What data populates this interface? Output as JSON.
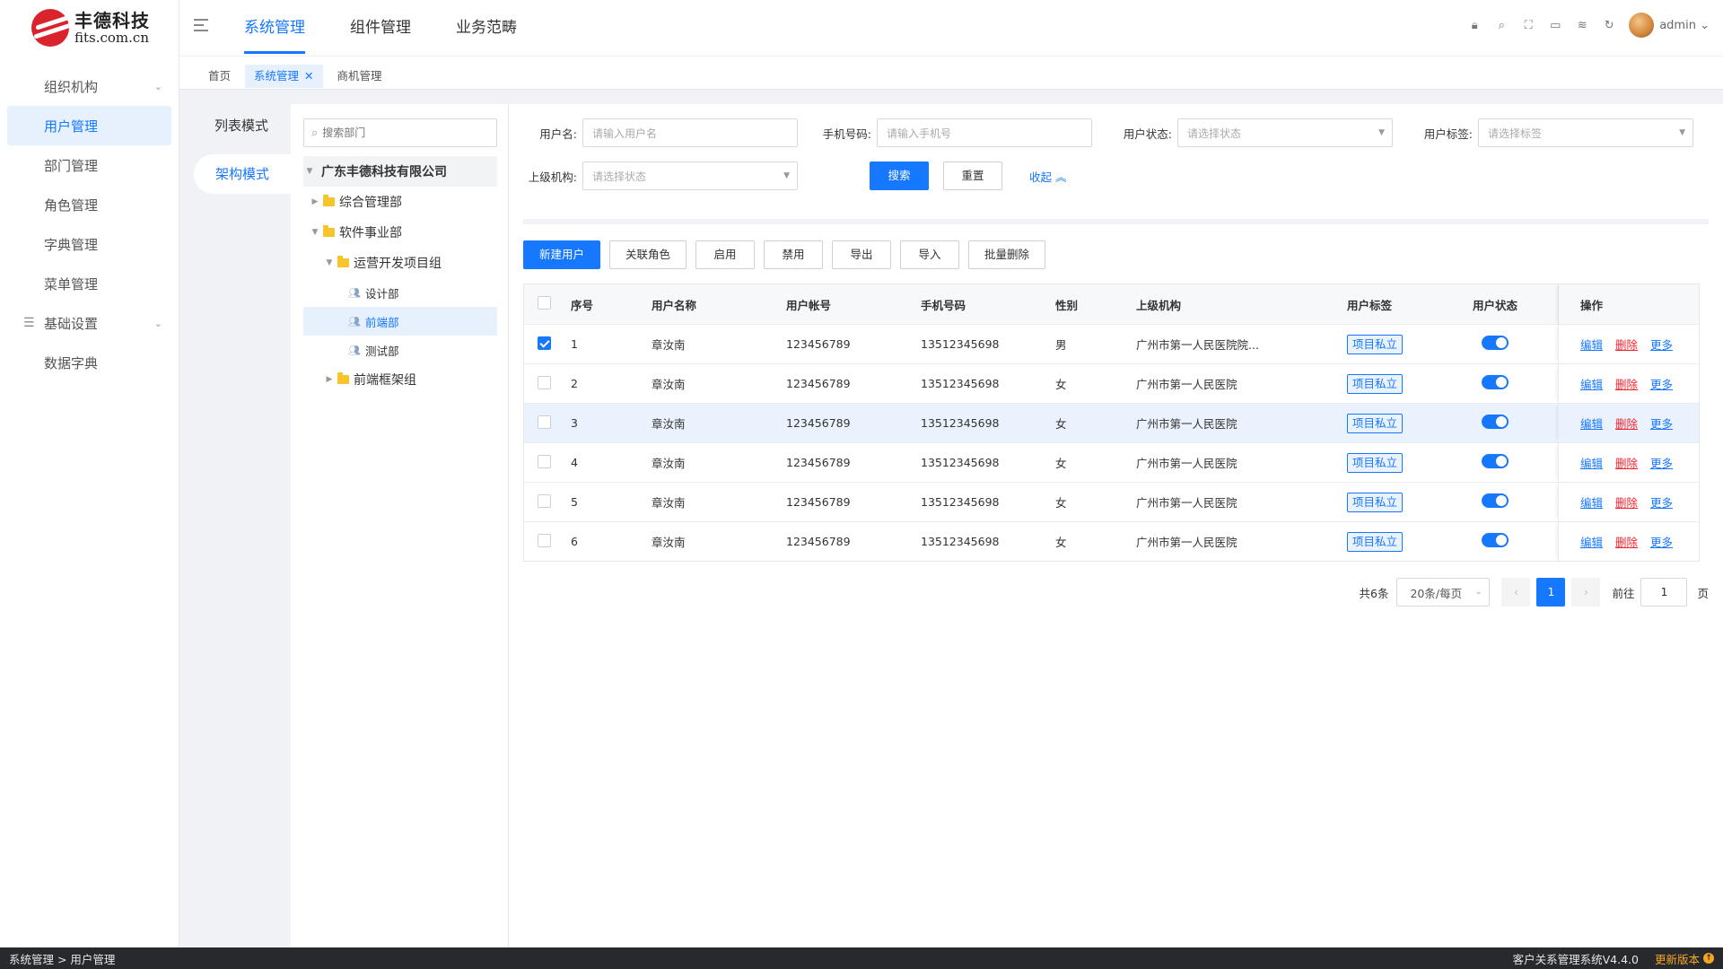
{
  "logo": {
    "cn": "丰德科技",
    "en": "fits.com.cn"
  },
  "sidebar": {
    "items": [
      {
        "label": "组织机构"
      },
      {
        "label": "用户管理"
      },
      {
        "label": "部门管理"
      },
      {
        "label": "角色管理"
      },
      {
        "label": "字典管理"
      },
      {
        "label": "菜单管理"
      },
      {
        "label": "基础设置"
      },
      {
        "label": "数据字典"
      }
    ]
  },
  "topnav": {
    "items": [
      {
        "label": "系统管理"
      },
      {
        "label": "组件管理"
      },
      {
        "label": "业务范畴"
      }
    ]
  },
  "user": {
    "name": "admin"
  },
  "tabs": [
    {
      "label": "首页"
    },
    {
      "label": "系统管理"
    },
    {
      "label": "商机管理"
    }
  ],
  "modes": [
    {
      "label": "列表模式"
    },
    {
      "label": "架构模式"
    }
  ],
  "tree": {
    "search_placeholder": "搜索部门",
    "root": "广东丰德科技有限公司",
    "n1": "综合管理部",
    "n2": "软件事业部",
    "n3": "运营开发项目组",
    "n4": "设计部",
    "n5": "前端部",
    "n6": "测试部",
    "n7": "前端框架组"
  },
  "filters": {
    "username_label": "用户名:",
    "username_placeholder": "请输入用户名",
    "phone_label": "手机号码:",
    "phone_placeholder": "请输入手机号",
    "status_label": "用户状态:",
    "status_placeholder": "请选择状态",
    "tag_label": "用户标签:",
    "tag_placeholder": "请选择标签",
    "org_label": "上级机构:",
    "org_placeholder": "请选择状态",
    "search_btn": "搜索",
    "reset_btn": "重置",
    "collapse_link": "收起"
  },
  "toolbar": {
    "new_user": "新建用户",
    "link_role": "关联角色",
    "enable": "启用",
    "disable": "禁用",
    "export": "导出",
    "import": "导入",
    "batch_delete": "批量删除"
  },
  "table": {
    "headers": {
      "no": "序号",
      "name": "用户名称",
      "account": "用户帐号",
      "phone": "手机号码",
      "sex": "性别",
      "org": "上级机构",
      "tag": "用户标签",
      "status": "用户状态",
      "ops": "操作"
    },
    "op_labels": {
      "edit": "编辑",
      "delete": "删除",
      "more": "更多"
    },
    "rows": [
      {
        "no": "1",
        "name": "章汝南",
        "account": "123456789",
        "phone": "13512345698",
        "sex": "男",
        "org": "广州市第一人民医院院...",
        "tag": "项目私立",
        "checked": true,
        "enabled": true
      },
      {
        "no": "2",
        "name": "章汝南",
        "account": "123456789",
        "phone": "13512345698",
        "sex": "女",
        "org": "广州市第一人民医院",
        "tag": "项目私立",
        "checked": false,
        "enabled": true
      },
      {
        "no": "3",
        "name": "章汝南",
        "account": "123456789",
        "phone": "13512345698",
        "sex": "女",
        "org": "广州市第一人民医院",
        "tag": "项目私立",
        "checked": false,
        "enabled": true
      },
      {
        "no": "4",
        "name": "章汝南",
        "account": "123456789",
        "phone": "13512345698",
        "sex": "女",
        "org": "广州市第一人民医院",
        "tag": "项目私立",
        "checked": false,
        "enabled": true
      },
      {
        "no": "5",
        "name": "章汝南",
        "account": "123456789",
        "phone": "13512345698",
        "sex": "女",
        "org": "广州市第一人民医院",
        "tag": "项目私立",
        "checked": false,
        "enabled": true
      },
      {
        "no": "6",
        "name": "章汝南",
        "account": "123456789",
        "phone": "13512345698",
        "sex": "女",
        "org": "广州市第一人民医院",
        "tag": "项目私立",
        "checked": false,
        "enabled": true
      }
    ]
  },
  "pager": {
    "total": "共6条",
    "page_size": "20条/每页",
    "prev": "‹",
    "current": "1",
    "next": "›",
    "goto_label": "前往",
    "goto_value": "1",
    "page_unit": "页"
  },
  "statusbar": {
    "breadcrumb": "系统管理 > 用户管理",
    "app_version": "客户关系管理系统V4.4.0",
    "update": "更新版本"
  },
  "colors": {
    "accent": "#1677ff",
    "danger": "#f5222d",
    "statusbar": "#27292d",
    "update": "#f5a623"
  }
}
